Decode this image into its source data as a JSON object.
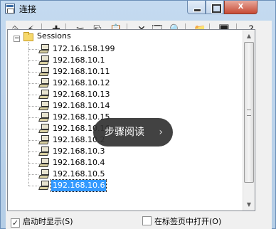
{
  "window": {
    "title": "连接",
    "buttons": {
      "minimize": "",
      "maximize": "",
      "close": "X"
    }
  },
  "toolbar": {
    "icons": [
      "connect-icon",
      "quick-connect-icon",
      "new-session-icon",
      "cut-icon",
      "copy-icon",
      "paste-icon",
      "delete-icon",
      "properties-icon",
      "find-icon",
      "new-folder-icon",
      "desktop-icon",
      "help-icon"
    ],
    "glyphs": [
      "⎆",
      "⚡",
      "✚",
      "✂",
      "⎘",
      "📋",
      "✕",
      "🗔",
      "🔍",
      "📁",
      "🖥",
      "?"
    ]
  },
  "tree": {
    "root_label": "Sessions",
    "root_expander": "−",
    "sessions": [
      "172.16.158.199",
      "192.168.10.1",
      "192.168.10.11",
      "192.168.10.12",
      "192.168.10.13",
      "192.168.10.14",
      "192.168.10.15",
      "192.168.10.16",
      "192.168.10.2",
      "192.168.10.3",
      "192.168.10.4",
      "192.168.10.5",
      "192.168.10.6"
    ],
    "selected_index": 12
  },
  "overlay": {
    "text": "步骤阅读",
    "chevron": "›"
  },
  "options": {
    "show_on_startup": {
      "label": "启动时显示(S)",
      "checked": true,
      "check_glyph": "✓"
    },
    "open_in_tab": {
      "label": "在标签页中打开(O)",
      "checked": false,
      "check_glyph": ""
    }
  },
  "scrollbar": {
    "up": "▲",
    "down": "▼"
  }
}
